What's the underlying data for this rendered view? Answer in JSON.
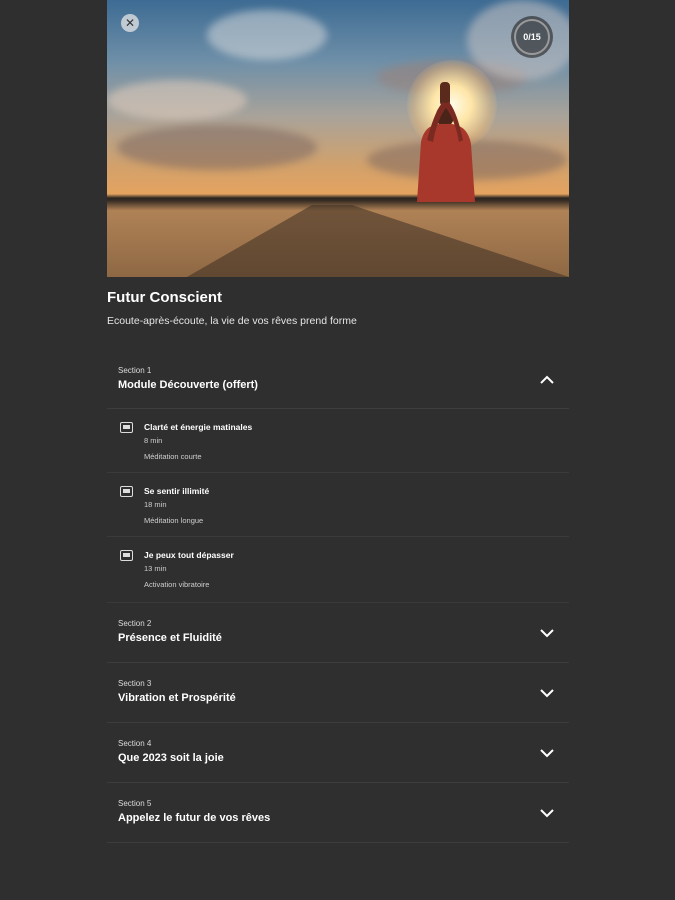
{
  "header": {
    "close_icon": "close-icon",
    "progress_label": "0/15",
    "progress_fraction": 0.0
  },
  "program": {
    "title": "Futur Conscient",
    "subtitle": "Ecoute-après-écoute, la vie de vos rêves prend forme"
  },
  "sections": [
    {
      "number": "Section 1",
      "name": "Module Découverte (offert)",
      "expanded": true,
      "lessons": [
        {
          "title": "Clarté et énergie matinales",
          "duration": "8 min",
          "type": "Méditation courte",
          "icon": "audio-lesson-icon"
        },
        {
          "title": "Se sentir illimité",
          "duration": "18 min",
          "type": "Méditation longue",
          "icon": "audio-lesson-icon"
        },
        {
          "title": "Je peux tout dépasser",
          "duration": "13 min",
          "type": "Activation vibratoire",
          "icon": "audio-lesson-icon"
        }
      ]
    },
    {
      "number": "Section 2",
      "name": "Présence et Fluidité",
      "expanded": false
    },
    {
      "number": "Section 3",
      "name": "Vibration et Prospérité",
      "expanded": false
    },
    {
      "number": "Section 4",
      "name": "Que 2023 soit la joie",
      "expanded": false
    },
    {
      "number": "Section 5",
      "name": "Appelez le futur de vos rêves",
      "expanded": false
    }
  ]
}
